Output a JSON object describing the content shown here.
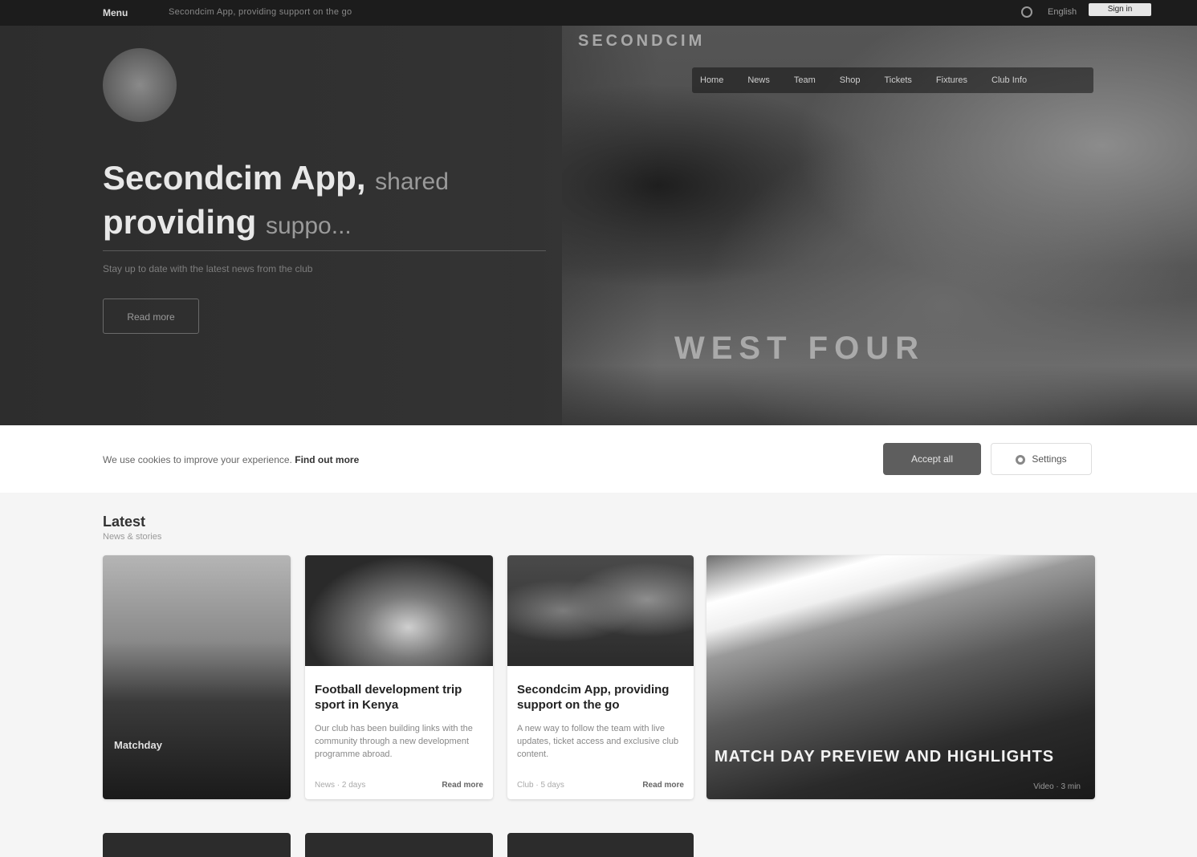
{
  "topbar": {
    "brand": "Menu",
    "tagline": "Secondcim App, providing support on the go",
    "lang": "English",
    "signin": "Sign in"
  },
  "hero": {
    "title_line1": "Secondcim App,",
    "title_line1_soft": "shared",
    "title_line2": "providing",
    "title_line2_soft": "suppo...",
    "subtitle": "Stay up to date with the latest news from the club",
    "cta": "Read more",
    "banner": "SECONDCIM",
    "board": "WEST FOUR",
    "nav": [
      "Home",
      "News",
      "Team",
      "Shop",
      "Tickets",
      "Fixtures",
      "Club Info"
    ]
  },
  "notice": {
    "text_prefix": "We use cookies to improve your experience.",
    "text_bold": "Find out more",
    "accept": "Accept all",
    "settings": "Settings"
  },
  "section": {
    "title": "Latest",
    "subtitle": "News & stories"
  },
  "cards": [
    {
      "overlay": "Matchday"
    },
    {
      "title": "Football development trip sport in Kenya",
      "desc": "Our club has been building links with the community through a new development programme abroad.",
      "meta": "News · 2 days",
      "more": "Read more"
    },
    {
      "title": "Secondcim App, providing support on the go",
      "desc": "A new way to follow the team with live updates, ticket access and exclusive club content.",
      "meta": "Club · 5 days",
      "more": "Read more"
    },
    {
      "feature_title": "MATCH DAY PREVIEW AND HIGHLIGHTS",
      "meta": "Video · 3 min"
    }
  ]
}
